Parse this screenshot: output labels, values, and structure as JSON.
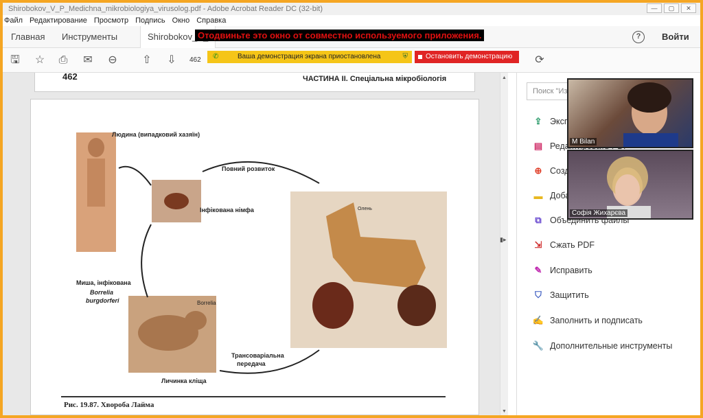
{
  "window": {
    "title": "Shirobokov_V_P_Medichna_mikrobiologiya_virusolog.pdf - Adobe Acrobat Reader DC (32-bit)"
  },
  "menu": [
    "Файл",
    "Редактирование",
    "Просмотр",
    "Подпись",
    "Окно",
    "Справка"
  ],
  "tabs": {
    "home": "Главная",
    "tools": "Инструменты",
    "document": "Shirobokov_V_"
  },
  "signin": "Войти",
  "share_warning": "Отодвиньте это окно от совместно используемого приложения.",
  "toolbar": {
    "page_number": "462"
  },
  "demo": {
    "paused_text": "Ваша демонстрация экрана приостановлена",
    "stop_label": "Остановить демонстрацию"
  },
  "document": {
    "page_number": "462",
    "chapter": "ЧАСТИНА II. Спеціальна мікробіологія",
    "labels": {
      "human": "Людина (випадковий хазяїн)",
      "full_development": "Повний розвиток",
      "nymph": "Інфікована німфа",
      "mouse": "Миша, інфікована",
      "borrelia1": "Borrelia",
      "borrelia2": "burgdorferi",
      "borrelia_small": "Borrelia",
      "transovarial1": "Трансоваріальна",
      "transovarial2": "передача",
      "larva": "Личинка кліща",
      "deer": "Олень"
    },
    "caption": "Рис. 19.87. Хвороба Лайма"
  },
  "right_pane": {
    "search_placeholder": "Поиск \"Из",
    "tools": [
      {
        "label": "Экспорт PDF",
        "color": "#2a9a6a"
      },
      {
        "label": "Редактировать PDF",
        "color": "#d0306a"
      },
      {
        "label": "Создать PDF",
        "color": "#e0402a"
      },
      {
        "label": "Добавить комментарий",
        "color": "#e8b820"
      },
      {
        "label": "Объединить файлы",
        "color": "#6a4ad0"
      },
      {
        "label": "Сжать PDF",
        "color": "#d03030"
      },
      {
        "label": "Исправить",
        "color": "#c02ab0"
      },
      {
        "label": "Защитить",
        "color": "#3a5ac0"
      },
      {
        "label": "Заполнить и подписать",
        "color": "#8a3ad0"
      },
      {
        "label": "Дополнительные инструменты",
        "color": "#555555"
      }
    ]
  },
  "participants": [
    {
      "name": "M Bilan"
    },
    {
      "name": "Софія Жихарєва"
    }
  ]
}
